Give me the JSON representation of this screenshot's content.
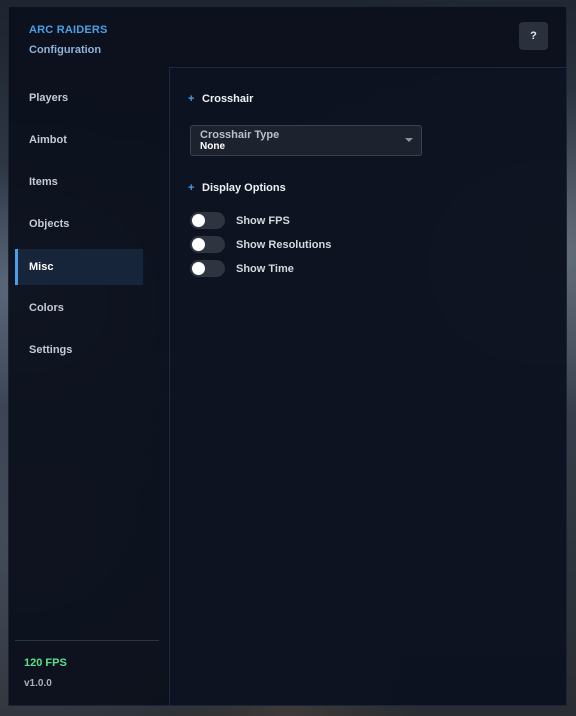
{
  "header": {
    "title": "ARC RAIDERS",
    "subtitle": "Configuration",
    "help_label": "?"
  },
  "sidebar": {
    "items": [
      {
        "label": "Players",
        "active": false
      },
      {
        "label": "Aimbot",
        "active": false
      },
      {
        "label": "Items",
        "active": false
      },
      {
        "label": "Objects",
        "active": false
      },
      {
        "label": "Misc",
        "active": true
      },
      {
        "label": "Colors",
        "active": false
      },
      {
        "label": "Settings",
        "active": false
      }
    ],
    "fps": "120 FPS",
    "version": "v1.0.0"
  },
  "content": {
    "crosshair_section": {
      "plus": "+",
      "title": "Crosshair",
      "dropdown": {
        "label": "Crosshair Type",
        "value": "None"
      }
    },
    "display_section": {
      "plus": "+",
      "title": "Display Options",
      "toggles": [
        {
          "label": "Show FPS",
          "on": false
        },
        {
          "label": "Show Resolutions",
          "on": false
        },
        {
          "label": "Show Time",
          "on": false
        }
      ]
    }
  },
  "colors": {
    "accent": "#4a9fe8",
    "fps_green": "#5fe08c",
    "panel_bg": "#0b101c"
  }
}
